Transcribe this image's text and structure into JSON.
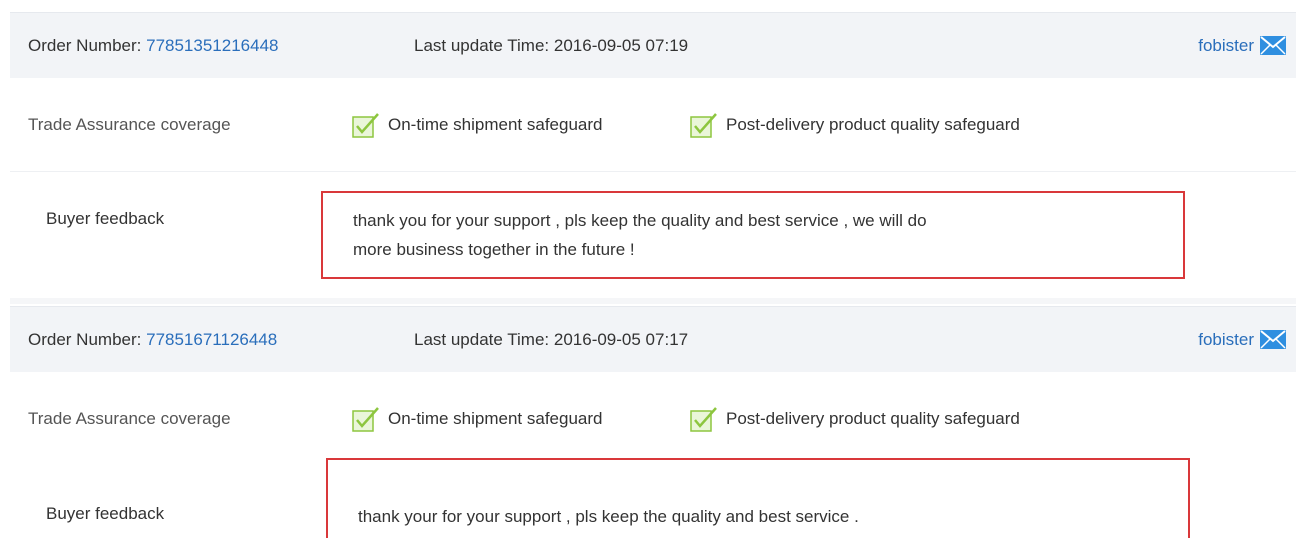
{
  "orders": [
    {
      "order_number_label": "Order Number:",
      "order_number": "77851351216448",
      "last_update_label": "Last update Time:",
      "last_update_time": "2016-09-05 07:19",
      "seller": "fobister",
      "coverage_label": "Trade Assurance coverage",
      "safeguards": [
        "On-time shipment safeguard",
        "Post-delivery product quality safeguard"
      ],
      "feedback_label": "Buyer feedback",
      "feedback_lines": [
        "thank you for your support , pls keep the quality and best service , we will do",
        "more business together in the future !"
      ]
    },
    {
      "order_number_label": "Order Number:",
      "order_number": "77851671126448",
      "last_update_label": "Last update Time:",
      "last_update_time": "2016-09-05 07:17",
      "seller": "fobister",
      "coverage_label": "Trade Assurance coverage",
      "safeguards": [
        "On-time shipment safeguard",
        "Post-delivery product quality safeguard"
      ],
      "feedback_label": "Buyer feedback",
      "feedback_lines": [
        "thank your for your support , pls keep the quality and best service ."
      ]
    }
  ],
  "colors": {
    "link": "#2a6ebb",
    "highlight_border": "#d9383a",
    "check_green": "#8dc63f",
    "header_bg": "#f2f4f7"
  },
  "icons": {
    "seller_message": "envelope-icon",
    "safeguard": "green-check-box-icon"
  }
}
